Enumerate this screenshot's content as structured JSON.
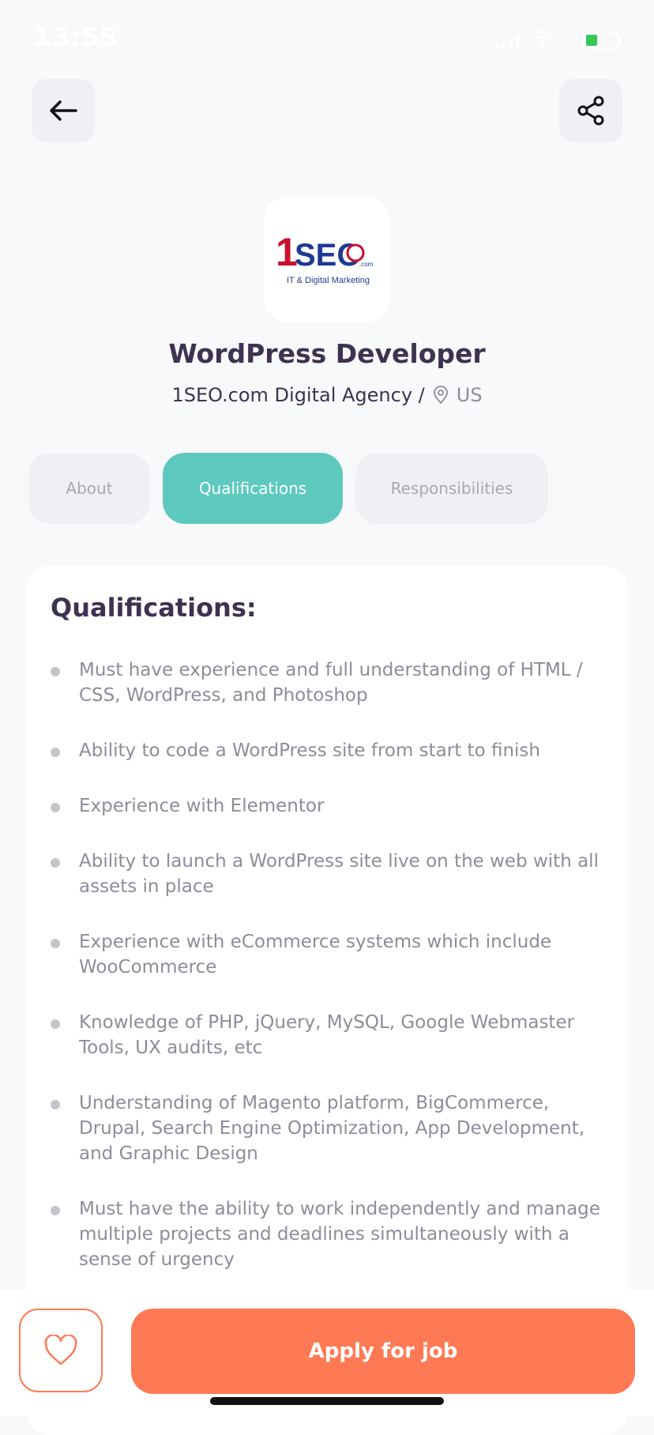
{
  "status_bar": {
    "time": "13:55",
    "moon_icon": "moon-icon",
    "signal_icon": "signal-icon",
    "wifi_icon": "wifi-icon",
    "battery_icon": "battery-icon"
  },
  "header": {
    "back_icon": "arrow-left-icon",
    "share_icon": "share-icon"
  },
  "company": {
    "logo_text_main": "1SEO",
    "logo_text_com": ".com",
    "logo_tagline": "IT & Digital Marketing",
    "name": "1SEO.com Digital Agency /",
    "location_icon": "map-pin-icon",
    "location": "US"
  },
  "job": {
    "title": "WordPress Developer"
  },
  "tabs": [
    {
      "label": "About",
      "active": false
    },
    {
      "label": "Qualifications",
      "active": true
    },
    {
      "label": "Responsibilities",
      "active": false
    }
  ],
  "qualifications": {
    "heading": "Qualifications:",
    "items": [
      "Must have experience and full understanding of HTML / CSS, WordPress, and Photoshop",
      "Ability to code a WordPress site from start to finish",
      "Experience with Elementor",
      "Ability to launch a WordPress site live on the web with all assets in place",
      "Experience with eCommerce systems which include WooCommerce",
      "Knowledge of PHP, jQuery, MySQL, Google Webmaster Tools, UX audits, etc",
      "Understanding of Magento platform, BigCommerce, Drupal, Search Engine Optimization, App Development, and Graphic Design",
      "Must have the ability to work independently and manage multiple projects and deadlines simultaneously with a sense of urgency"
    ]
  },
  "actions": {
    "favorite_icon": "heart-icon",
    "apply_label": "Apply for job"
  },
  "colors": {
    "accent_teal": "#5EC9BE",
    "accent_orange": "#FF7A54",
    "title": "#3E3251",
    "muted": "#8E8C99"
  }
}
